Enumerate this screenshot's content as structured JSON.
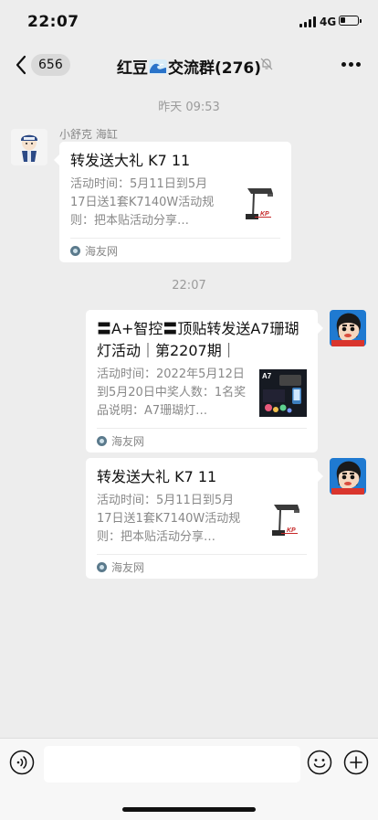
{
  "status_bar": {
    "time": "22:07",
    "network": "4G",
    "battery_level": 0.3
  },
  "nav": {
    "back_count": "656",
    "title_prefix": "红豆",
    "title_suffix": "交流群(276)",
    "icons": [
      "back-arrow-icon",
      "wave-emoji-icon",
      "mute-bell-icon",
      "more-icon"
    ]
  },
  "messages": {
    "timestamp_1": "昨天 09:53",
    "timestamp_2": "22:07",
    "msg1": {
      "sender": "小舒克 海缸",
      "title": "转发送大礼 K7 11",
      "desc": "活动时间：5月11日到5月17日送1套K7140W活动规则：把本贴活动分享…",
      "source": "海友网"
    },
    "msg2": {
      "title": "〓A+智控〓顶贴转发送A7珊瑚灯活动｜第2207期｜",
      "desc": "活动时间：2022年5月12日到5月20日中奖人数：1名奖品说明：A7珊瑚灯…",
      "thumb_label": "A7",
      "source": "海友网"
    },
    "msg3": {
      "title": "转发送大礼 K7 11",
      "desc": "活动时间：5月11日到5月17日送1套K7140W活动规则：把本贴活动分享…",
      "source": "海友网"
    }
  },
  "input_bar": {
    "placeholder": "",
    "icons": [
      "voice-icon",
      "emoji-icon",
      "plus-icon"
    ]
  },
  "colors": {
    "background": "#ededed",
    "card": "#ffffff",
    "meta_text": "#888888",
    "timestamp": "#9b9b9b"
  }
}
